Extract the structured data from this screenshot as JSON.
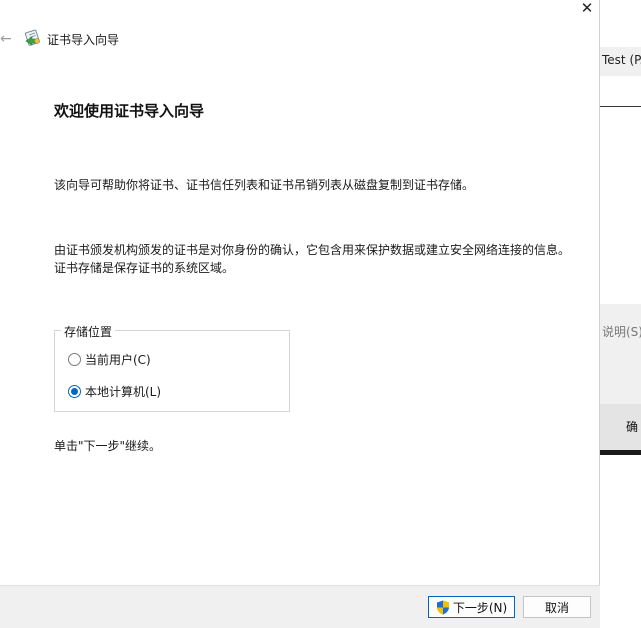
{
  "window": {
    "title": "证书导入向导",
    "close_glyph": "✕",
    "back_glyph": "←"
  },
  "content": {
    "heading": "欢迎使用证书导入向导",
    "paragraph1": "该向导可帮助你将证书、证书信任列表和证书吊销列表从磁盘复制到证书存储。",
    "paragraph2": "由证书颁发机构颁发的证书是对你身份的确认，它包含用来保护数据或建立安全网络连接的信息。证书存储是保存证书的系统区域。",
    "continue_hint": "单击\"下一步\"继续。"
  },
  "store_location": {
    "legend": "存储位置",
    "options": [
      {
        "label": "当前用户(C)",
        "checked": false
      },
      {
        "label": "本地计算机(L)",
        "checked": true
      }
    ]
  },
  "buttons": {
    "next_label": "下一步(N)",
    "cancel_label": "取消"
  },
  "background_window": {
    "column_text": "Test (P...",
    "description_text": "说明(S)",
    "ok_text": "确"
  },
  "colors": {
    "accent": "#0067c0",
    "shield_blue": "#1f6fd1",
    "shield_yellow": "#f2c200"
  },
  "icons": {
    "window_icon": "certificate-icon",
    "uac_icon": "uac-shield-icon"
  }
}
